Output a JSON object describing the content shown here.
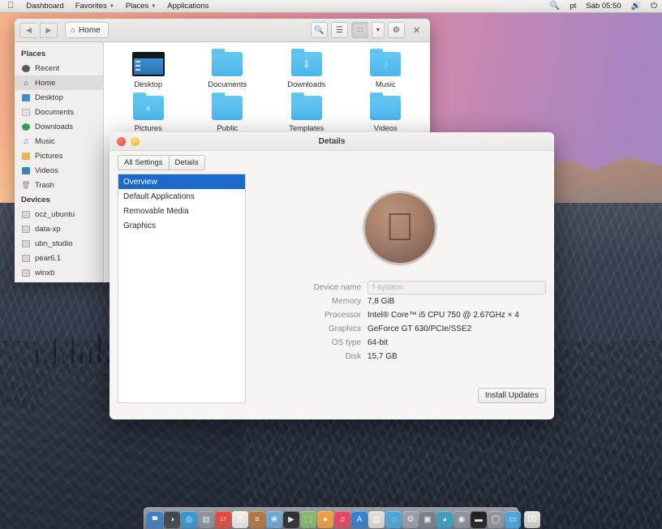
{
  "menubar": {
    "logo_icon": "apple-logo-icon",
    "items": [
      {
        "label": "Dashboard",
        "caret": false
      },
      {
        "label": "Favorites",
        "caret": true
      },
      {
        "label": "Places",
        "caret": true
      },
      {
        "label": "Applications",
        "caret": false
      }
    ],
    "status": {
      "search_icon": "search-icon",
      "keyboard_layout": "pt",
      "clock": "Sáb 05:50",
      "volume_icon": "volume-icon",
      "power_icon": "power-icon"
    }
  },
  "filemanager": {
    "back_icon": "arrow-left-icon",
    "forward_icon": "arrow-right-icon",
    "path_label": "Home",
    "path_icon": "home-icon",
    "toolbar": {
      "search_icon": "search-icon",
      "list_view_icon": "list-view-icon",
      "grid_view_icon": "grid-view-icon",
      "view_menu_icon": "chevron-down-icon",
      "settings_icon": "gear-icon",
      "close_icon": "close-icon"
    },
    "sidebar": {
      "places_header": "Places",
      "places": [
        {
          "label": "Recent",
          "icon": "recent-icon",
          "color": "#555a5f",
          "selected": false
        },
        {
          "label": "Home",
          "icon": "home-icon",
          "color": "#6f7479",
          "selected": true
        },
        {
          "label": "Desktop",
          "icon": "desktop-icon",
          "color": "#3d8fd0",
          "selected": false
        },
        {
          "label": "Documents",
          "icon": "document-icon",
          "color": "#d8d6d2",
          "selected": false
        },
        {
          "label": "Downloads",
          "icon": "downloads-icon",
          "color": "#33a05a",
          "selected": false
        },
        {
          "label": "Music",
          "icon": "music-icon",
          "color": "#4a8fd6",
          "selected": false
        },
        {
          "label": "Pictures",
          "icon": "pictures-icon",
          "color": "#e8b45c",
          "selected": false
        },
        {
          "label": "Videos",
          "icon": "videos-icon",
          "color": "#3f7fc4",
          "selected": false
        },
        {
          "label": "Trash",
          "icon": "trash-icon",
          "color": "#9a9793",
          "selected": false
        }
      ],
      "devices_header": "Devices",
      "devices": [
        {
          "label": "ocz_ubuntu",
          "icon": "drive-icon"
        },
        {
          "label": "data-xp",
          "icon": "drive-icon"
        },
        {
          "label": "ubn_studio",
          "icon": "drive-icon"
        },
        {
          "label": "pear6.1",
          "icon": "drive-icon"
        },
        {
          "label": "winxb",
          "icon": "drive-icon"
        }
      ]
    },
    "files": [
      {
        "name": "Desktop",
        "icon": "desktop-screen-icon"
      },
      {
        "name": "Documents",
        "icon": "folder-icon",
        "emblem": ""
      },
      {
        "name": "Downloads",
        "icon": "folder-icon",
        "emblem": "⬇"
      },
      {
        "name": "Music",
        "icon": "folder-icon",
        "emblem": "♪"
      },
      {
        "name": "Pictures",
        "icon": "folder-icon",
        "emblem": "▲"
      },
      {
        "name": "Public",
        "icon": "folder-icon",
        "emblem": ""
      },
      {
        "name": "Templates",
        "icon": "folder-icon",
        "emblem": ""
      },
      {
        "name": "Videos",
        "icon": "folder-icon",
        "emblem": ""
      }
    ]
  },
  "details_window": {
    "title": "Details",
    "close_button_label": "",
    "minimize_button_label": "",
    "tabs": [
      {
        "label": "All Settings"
      },
      {
        "label": "Details"
      }
    ],
    "nav_items": [
      {
        "label": "Overview",
        "selected": true
      },
      {
        "label": "Default Applications",
        "selected": false
      },
      {
        "label": "Removable Media",
        "selected": false
      },
      {
        "label": "Graphics",
        "selected": false
      }
    ],
    "logo_icon": "apple-logo-badge-icon",
    "specs": [
      {
        "label": "Device name",
        "value": "f-system",
        "is_field": true
      },
      {
        "label": "Memory",
        "value": "7,8 GiB",
        "is_field": false
      },
      {
        "label": "Processor",
        "value": "Intel® Core™ i5 CPU 750 @ 2.67GHz × 4",
        "is_field": false
      },
      {
        "label": "Graphics",
        "value": "GeForce GT 630/PCIe/SSE2",
        "is_field": false
      },
      {
        "label": "OS type",
        "value": "64-bit",
        "is_field": false
      },
      {
        "label": "Disk",
        "value": "15,7 GB",
        "is_field": false
      }
    ],
    "install_updates_label": "Install Updates"
  },
  "dock": {
    "items": [
      {
        "name": "finder",
        "color": "#3a7fc4",
        "glyph": "🖿"
      },
      {
        "name": "dashboard",
        "color": "#3e4449",
        "glyph": "◑"
      },
      {
        "name": "safari",
        "color": "#2f9ad6",
        "glyph": "◎"
      },
      {
        "name": "addressbook",
        "color": "#8c9299",
        "glyph": "▤"
      },
      {
        "name": "calendar",
        "color": "#e8463c",
        "glyph": "17"
      },
      {
        "name": "notes",
        "color": "#f2f0e6",
        "glyph": "☰"
      },
      {
        "name": "reminders",
        "color": "#b8763c",
        "glyph": "≡"
      },
      {
        "name": "photos",
        "color": "#6fa8d6",
        "glyph": "❀"
      },
      {
        "name": "video",
        "color": "#2b2b2b",
        "glyph": "▶"
      },
      {
        "name": "files",
        "color": "#88b86c",
        "glyph": "⬚"
      },
      {
        "name": "messages",
        "color": "#f2a13c",
        "glyph": "●"
      },
      {
        "name": "itunes",
        "color": "#e8465f",
        "glyph": "♫"
      },
      {
        "name": "appstore",
        "color": "#2f7fd6",
        "glyph": "A"
      },
      {
        "name": "documents",
        "color": "#e4e2da",
        "glyph": "▧"
      },
      {
        "name": "browser",
        "color": "#4aa8e0",
        "glyph": "◌"
      },
      {
        "name": "settings",
        "color": "#9aa0a6",
        "glyph": "⚙"
      },
      {
        "name": "preview",
        "color": "#7a8086",
        "glyph": "▣"
      },
      {
        "name": "terminal",
        "color": "#3aa0c4",
        "glyph": "◕"
      },
      {
        "name": "disk",
        "color": "#8c9299",
        "glyph": "◉"
      },
      {
        "name": "display",
        "color": "#1c1c1c",
        "glyph": "▬"
      },
      {
        "name": "camera",
        "color": "#8f959b",
        "glyph": "◯"
      },
      {
        "name": "desktop",
        "color": "#4aa8e0",
        "glyph": "▭"
      },
      {
        "name": "trash",
        "color": "#e9e7e0",
        "glyph": "⌧"
      }
    ]
  }
}
